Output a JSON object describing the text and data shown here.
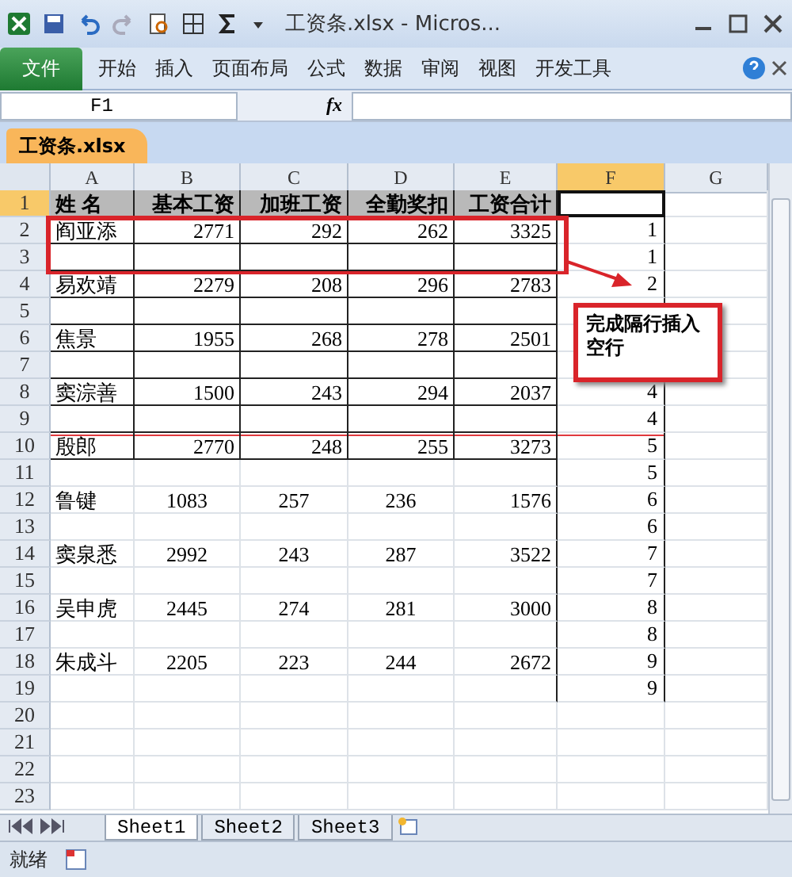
{
  "window": {
    "title": "工资条.xlsx - Micros..."
  },
  "ribbon_tabs": [
    {
      "label": "文件",
      "kind": "file"
    },
    {
      "label": "开始",
      "kind": "tab"
    },
    {
      "label": "插入",
      "kind": "tab"
    },
    {
      "label": "页面布局",
      "kind": "tab"
    },
    {
      "label": "公式",
      "kind": "tab"
    },
    {
      "label": "数据",
      "kind": "tab"
    },
    {
      "label": "审阅",
      "kind": "tab"
    },
    {
      "label": "视图",
      "kind": "tab"
    },
    {
      "label": "开发工具",
      "kind": "tab"
    }
  ],
  "formula_bar": {
    "name_box": "F1",
    "fx_label": "fx"
  },
  "workbook_tab": "工资条.xlsx",
  "columns": [
    {
      "label": "A",
      "selected": false
    },
    {
      "label": "B",
      "selected": false
    },
    {
      "label": "C",
      "selected": false
    },
    {
      "label": "D",
      "selected": false
    },
    {
      "label": "E",
      "selected": false
    },
    {
      "label": "F",
      "selected": true
    },
    {
      "label": "G",
      "selected": false
    }
  ],
  "rows": [
    {
      "num": "1",
      "kind": "header",
      "selected": true,
      "cells": [
        "姓  名",
        "基本工资",
        "加班工资",
        "全勤奖扣",
        "工资合计"
      ]
    },
    {
      "num": "2",
      "kind": "bordered",
      "selected": false,
      "cells": [
        "阎亚添",
        "2771",
        "292",
        "262",
        "3325"
      ],
      "f": "1"
    },
    {
      "num": "3",
      "kind": "bordered",
      "selected": false,
      "f": "1"
    },
    {
      "num": "4",
      "kind": "bordered",
      "selected": false,
      "cells": [
        "易欢靖",
        "2279",
        "208",
        "296",
        "2783"
      ],
      "f": "2"
    },
    {
      "num": "5",
      "kind": "bordered",
      "selected": false
    },
    {
      "num": "6",
      "kind": "bordered",
      "selected": false,
      "cells": [
        "焦景",
        "1955",
        "268",
        "278",
        "2501"
      ]
    },
    {
      "num": "7",
      "kind": "bordered",
      "selected": false
    },
    {
      "num": "8",
      "kind": "bordered",
      "selected": false,
      "cells": [
        "窦淙善",
        "1500",
        "243",
        "294",
        "2037"
      ],
      "f": "4"
    },
    {
      "num": "9",
      "kind": "bordered",
      "selected": false,
      "f": "4"
    },
    {
      "num": "10",
      "kind": "bordered",
      "selected": false,
      "cells": [
        "殷郎",
        "2770",
        "248",
        "255",
        "3273"
      ],
      "f": "5"
    },
    {
      "num": "11",
      "kind": "plain",
      "selected": false,
      "f": "5"
    },
    {
      "num": "12",
      "kind": "plain",
      "selected": false,
      "cells": [
        "鲁键",
        "1083",
        "257",
        "236",
        "1576"
      ],
      "f": "6"
    },
    {
      "num": "13",
      "kind": "plain",
      "selected": false,
      "f": "6"
    },
    {
      "num": "14",
      "kind": "plain",
      "selected": false,
      "cells": [
        "窦泉悉",
        "2992",
        "243",
        "287",
        "3522"
      ],
      "f": "7"
    },
    {
      "num": "15",
      "kind": "plain",
      "selected": false,
      "f": "7"
    },
    {
      "num": "16",
      "kind": "plain",
      "selected": false,
      "cells": [
        "吴申虎",
        "2445",
        "274",
        "281",
        "3000"
      ],
      "f": "8"
    },
    {
      "num": "17",
      "kind": "plain",
      "selected": false,
      "f": "8"
    },
    {
      "num": "18",
      "kind": "plain",
      "selected": false,
      "cells": [
        "朱成斗",
        "2205",
        "223",
        "244",
        "2672"
      ],
      "f": "9"
    },
    {
      "num": "19",
      "kind": "plain",
      "selected": false,
      "f": "9"
    },
    {
      "num": "20",
      "kind": "empty",
      "selected": false
    },
    {
      "num": "21",
      "kind": "empty",
      "selected": false
    },
    {
      "num": "22",
      "kind": "empty",
      "selected": false
    },
    {
      "num": "23",
      "kind": "empty",
      "selected": false
    }
  ],
  "callout": "完成隔行插入空行",
  "sheet_tabs": [
    {
      "label": "Sheet1",
      "selected": true
    },
    {
      "label": "Sheet2",
      "selected": false
    },
    {
      "label": "Sheet3",
      "selected": false
    }
  ],
  "status_bar": {
    "text": "就绪"
  }
}
